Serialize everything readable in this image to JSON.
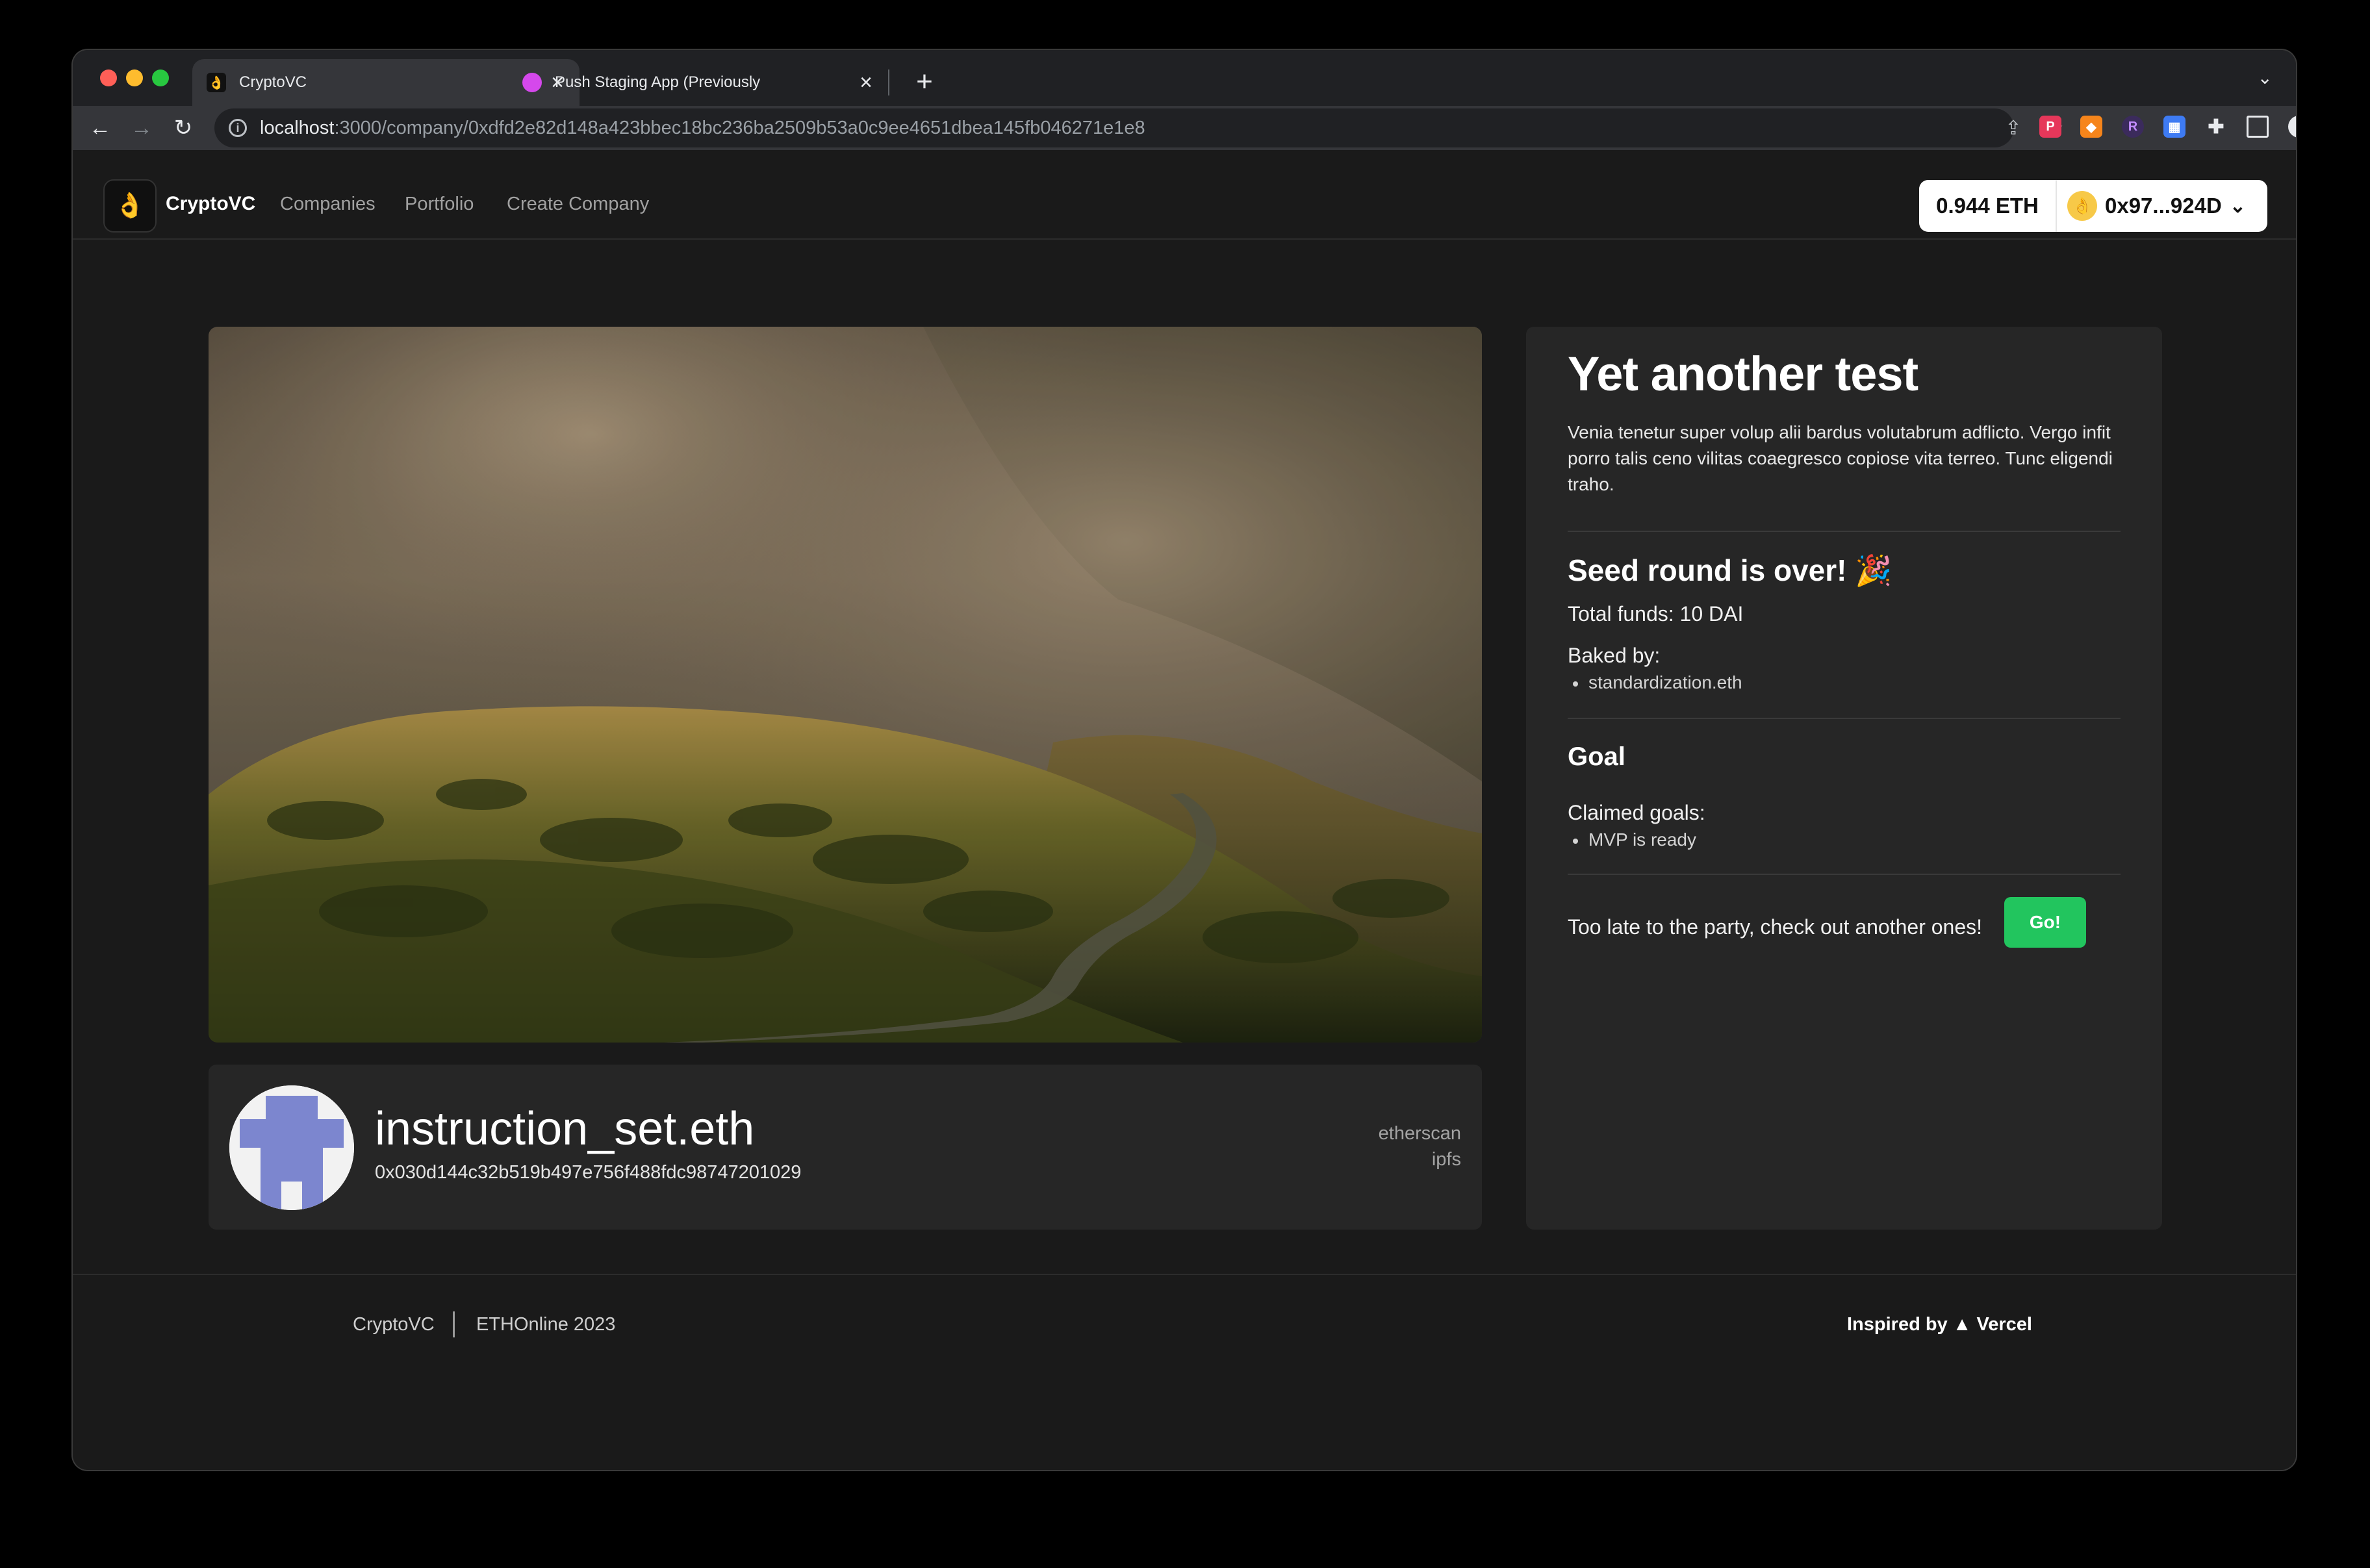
{
  "browser": {
    "tabs": [
      {
        "title": "CryptoVC",
        "active": true,
        "favicon": "ok-hand-emoji"
      },
      {
        "title": "Push Staging App (Previously",
        "active": false,
        "favicon": "bell-icon"
      }
    ],
    "url": {
      "host": "localhost",
      "path": ":3000/company/0xdfd2e82d148a423bbec18bc236ba2509b53a0c9ee4651dbea145fb046271e1e8"
    }
  },
  "app": {
    "brand": "CryptoVC",
    "nav": [
      "Companies",
      "Portfolio",
      "Create Company"
    ],
    "wallet": {
      "balance": "0.944 ETH",
      "account": "0x97...924D"
    }
  },
  "owner": {
    "ens": "instruction_set.eth",
    "address": "0x030d144c32b519b497e756f488fdc98747201029",
    "links": [
      "etherscan",
      "ipfs"
    ]
  },
  "company": {
    "title": "Yet another test",
    "description": "Venia tenetur super volup alii bardus volutabrum adflicto. Vergo infit porro talis ceno vilitas coaegresco copiose vita terreo. Tunc eligendi traho.",
    "round": {
      "heading": "Seed round is over! 🎉",
      "total_funds": "Total funds: 10 DAI",
      "backed_label": "Baked by:",
      "backers": [
        "standardization.eth"
      ]
    },
    "goal": {
      "heading": "Goal",
      "claimed_label": "Claimed goals:",
      "claimed": [
        "MVP is ready"
      ]
    },
    "cta": {
      "text": "Too late to the party, check out another ones!",
      "button": "Go!"
    }
  },
  "footer": {
    "brand": "CryptoVC",
    "event": "ETHOnline 2023",
    "inspired": "Inspired by ▲ Vercel"
  },
  "colors": {
    "accent_green": "#22c55e",
    "page_bg": "#1a1a1a",
    "card_bg": "#262626"
  }
}
